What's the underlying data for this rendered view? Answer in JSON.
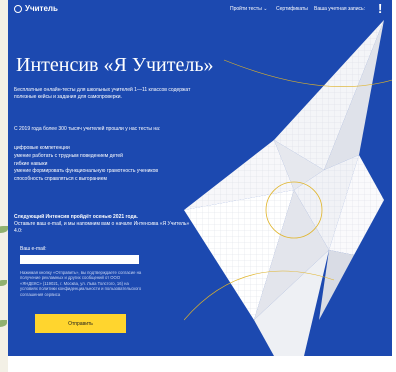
{
  "header": {
    "logo_text": "Учитель",
    "nav_tests": "Пройти тесты ⌄",
    "nav_certificates": "Сертификаты",
    "nav_account": "Ваша учетная запись:",
    "nav_exclaim": "!"
  },
  "hero": {
    "title": "Интенсив «Я Учитель»",
    "intro": "Бесплатные онлайн-тесты для школьных учителей 1—11 классов содержат полезные кейсы и задания для самопроверки.",
    "since": "С 2019 года более 300 тысяч учителей прошли у нас тесты на:",
    "skills": [
      "цифровые компетенции",
      "умение работать с трудным поведением детей",
      "гибкие навыки",
      "умение формировать функциональную грамотность учеников",
      "способность справляться с выгоранием"
    ],
    "next_title": "Следующий Интенсив пройдёт осенью 2021 года.",
    "next_text": "Оставьте ваш e-mail, и мы напомним вам о начале Интенсива «Я Учитель» 4.0:"
  },
  "form": {
    "email_label": "Ваш e-mail:",
    "email_placeholder": "",
    "consent_text": "Нажимая кнопку «Отправить», вы подтверждаете согласие на получение рекламных и других сообщений от ООО «ЯНДЕКС» (119021, г. Москва, ул. Льва Толстого, 16) на условиях политики конфиденциальности и пользовательского соглашения сервиса",
    "submit_label": "Отправить"
  },
  "colors": {
    "hero_bg": "#1c49b0",
    "button_bg": "#ffd52e",
    "accent_line": "#e0b428"
  },
  "icons": {
    "logo": "yandex-logo-icon",
    "illustration": "origami-bird-icon"
  }
}
